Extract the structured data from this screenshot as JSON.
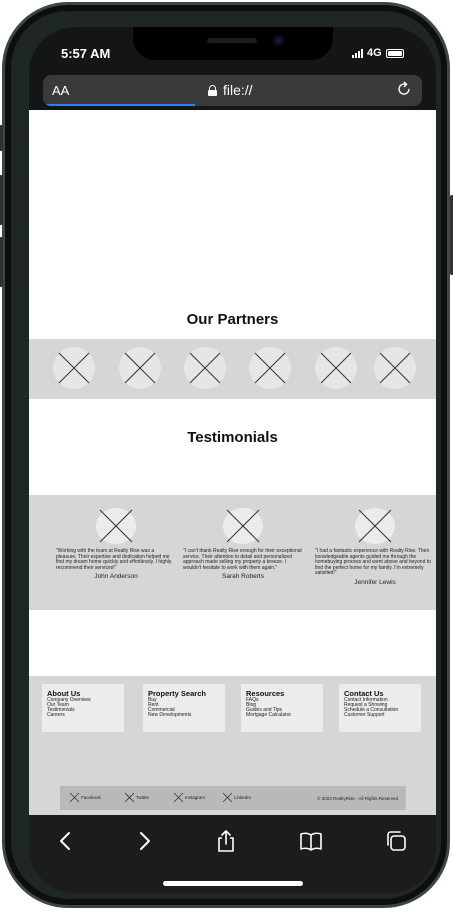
{
  "status_bar": {
    "time": "5:57 AM",
    "network": "4G"
  },
  "browser": {
    "font_size_label": "AA",
    "url": "file://"
  },
  "partners": {
    "title": "Our Partners",
    "logos": [
      "placeholder-image",
      "placeholder-image",
      "placeholder-image",
      "placeholder-image",
      "placeholder-image",
      "placeholder-image"
    ]
  },
  "testimonials": {
    "title": "Testimonials",
    "items": [
      {
        "quote": "\"Working with the team at Realty Rise was a pleasure. Their expertise and dedication helped me find my dream home quickly and effortlessly. I highly recommend their services!\"",
        "name": "John Anderson"
      },
      {
        "quote": "\"I can't thank Realty Rise enough for their exceptional service. Their attention to detail and personalized approach made selling my property a breeze. I wouldn't hesitate to work with them again.\"",
        "name": "Sarah Roberts"
      },
      {
        "quote": "\"I had a fantastic experience with Realty Rise. Their knowledgeable agents guided me through the homebuying process and went above and beyond to find the perfect home for my family. I'm extremely satisfied!\"",
        "name": "Jennifer Lewis"
      }
    ]
  },
  "footer": {
    "columns": [
      {
        "title": "About Us",
        "links": [
          "Company Overview",
          "Our Team",
          "Testimonials",
          "Careers"
        ]
      },
      {
        "title": "Property Search",
        "links": [
          "Buy",
          "Rent",
          "Commercial",
          "New Developments"
        ]
      },
      {
        "title": "Resources",
        "links": [
          "FAQs",
          "Blog",
          "Guides and Tips",
          "Mortgage Calculator"
        ]
      },
      {
        "title": "Contact Us",
        "links": [
          "Contact Information",
          "Request a Showing",
          "Schedule a Consultation",
          "Customer Support"
        ]
      }
    ],
    "social": [
      "Facebook",
      "Twitter",
      "Instagram",
      "LinkedIn"
    ],
    "copyright": "© 2023 RealtyRise - All Rights Reserved"
  },
  "toolbar": {
    "icons": [
      "back-icon",
      "forward-icon",
      "share-icon",
      "bookmarks-icon",
      "tabs-icon"
    ]
  },
  "colors": {
    "band": "#d6d6d6",
    "accent": "#2f7ff5",
    "toolbar": "#1c1c1e"
  }
}
